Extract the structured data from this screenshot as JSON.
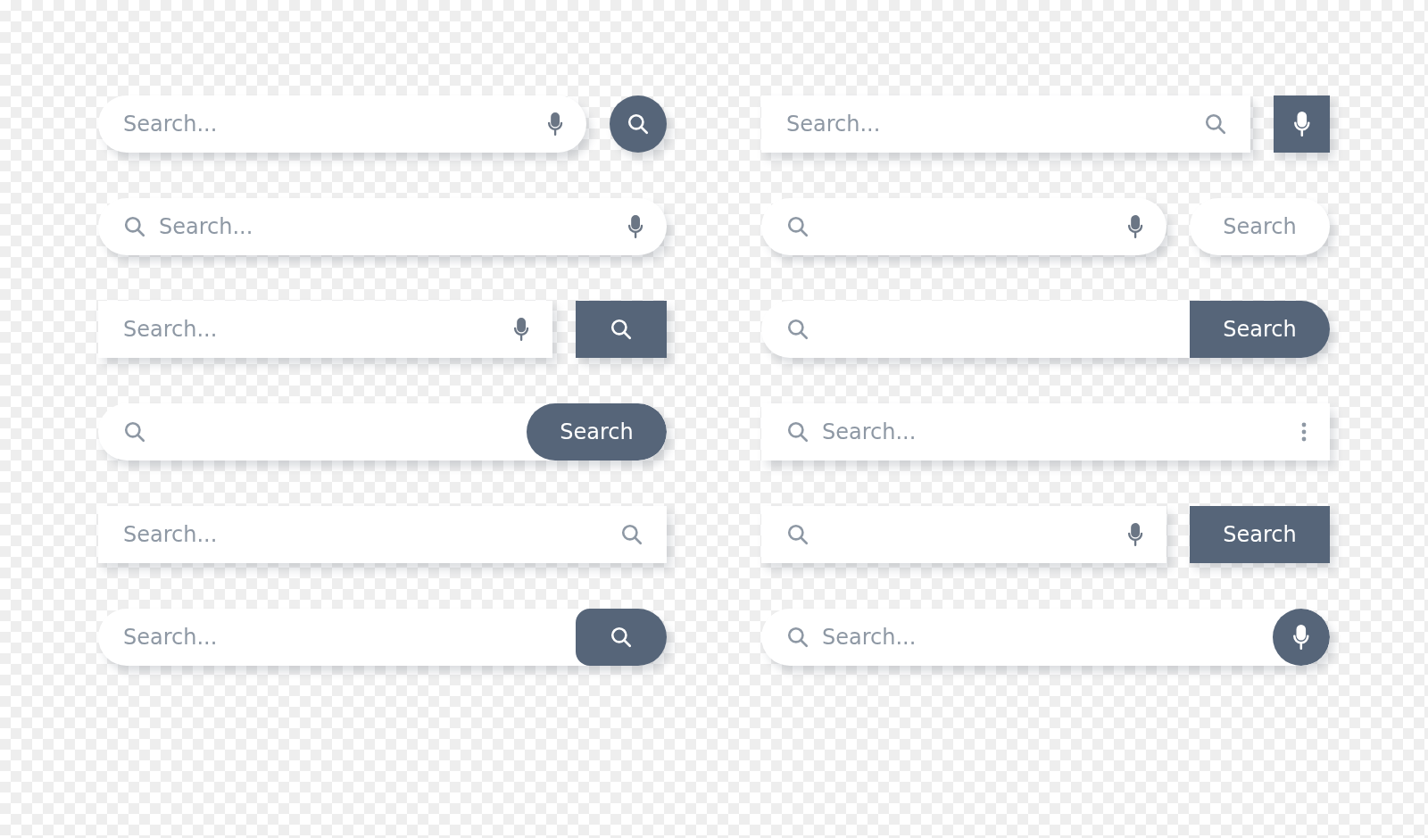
{
  "search_bars": [
    {
      "kind": "roundbutton",
      "placeholder": "Search..."
    },
    {
      "kind": "micbutton",
      "placeholder": "Search..."
    },
    {
      "kind": "voicefield",
      "placeholder": "Search..."
    },
    {
      "kind": "lightbutton",
      "button_label": "Search"
    },
    {
      "kind": "squarebutton",
      "placeholder": "Search..."
    },
    {
      "kind": "joinedbutton",
      "button_label": "Search"
    },
    {
      "kind": "inlinebutton",
      "button_label": "Search"
    },
    {
      "kind": "menufield",
      "placeholder": "Search..."
    },
    {
      "kind": "plainfield",
      "placeholder": "Search..."
    },
    {
      "kind": "blockbutton",
      "button_label": "Search"
    },
    {
      "kind": "tabbutton",
      "placeholder": "Search..."
    },
    {
      "kind": "micdot",
      "placeholder": "Search..."
    }
  ]
}
